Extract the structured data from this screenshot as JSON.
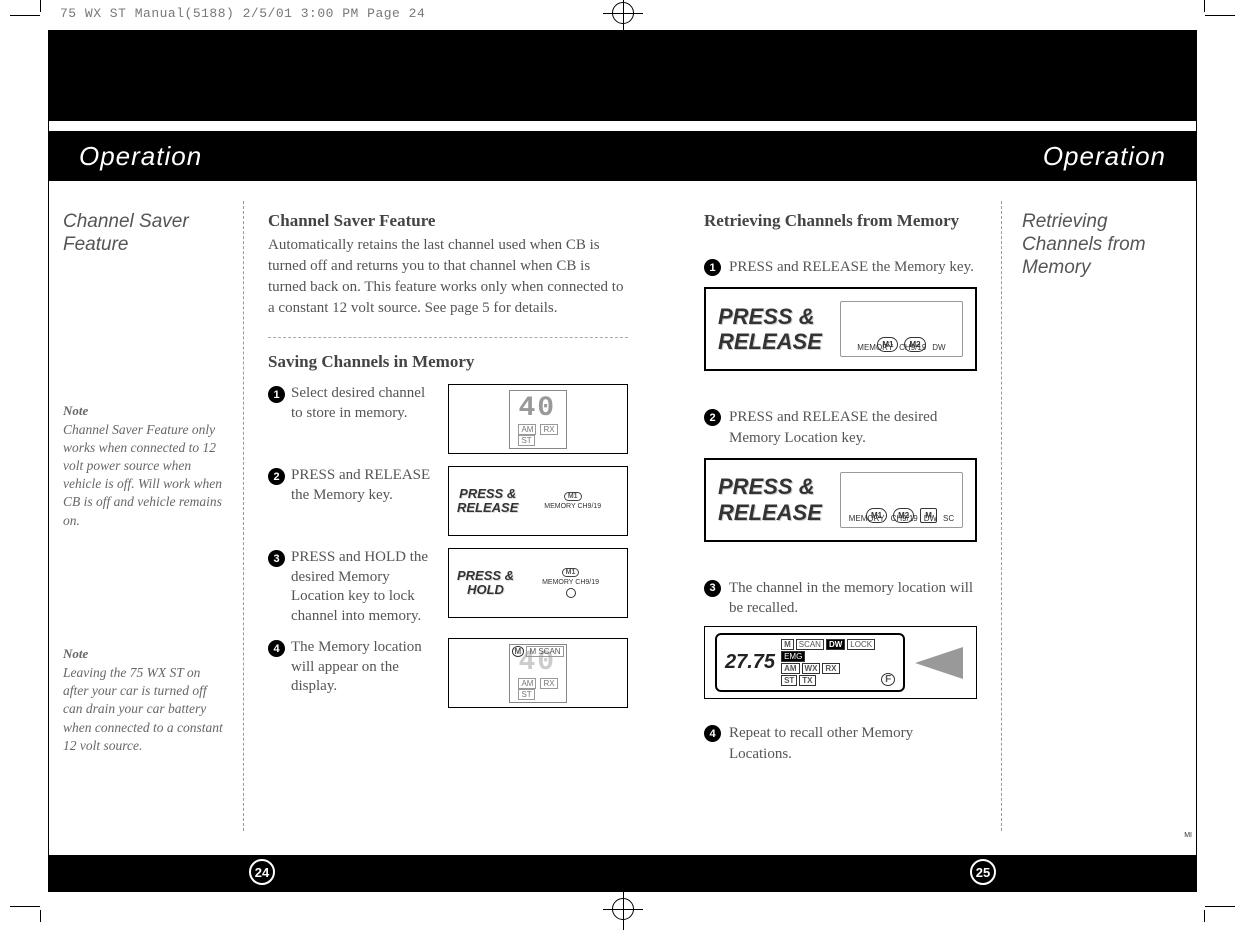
{
  "header_info": "75 WX ST Manual(5188)  2/5/01  3:00 PM  Page 24",
  "titles": {
    "left": "Operation",
    "right": "Operation"
  },
  "left_side": {
    "title": "Channel Saver Feature",
    "note1_label": "Note",
    "note1_body": "Channel Saver Feature only works when connected to 12 volt power source when vehicle is off. Will work when CB is off and vehicle remains on.",
    "note2_label": "Note",
    "note2_body": "Leaving the 75 WX ST on after your car is turned off can drain your car battery when connected to a constant 12 volt source."
  },
  "left_main": {
    "sec1_title": "Channel Saver Feature",
    "sec1_body": "Automatically retains the last channel used when CB is turned off and returns you to that channel when CB is turned back on. This feature works only when connected to a constant 12 volt source. See page 5 for details.",
    "sec2_title": "Saving Channels in Memory",
    "steps": [
      "Select desired channel to store in memory.",
      "PRESS and RELEASE the Memory key.",
      "PRESS and HOLD the desired Memory Location key to lock channel into memory.",
      "The Memory location will appear on the display."
    ],
    "press_release_label": "PRESS &\nRELEASE",
    "press_hold_label": "PRESS &\nHOLD",
    "lcd_40": "40",
    "lcd_tags_am": "AM",
    "lcd_tags_rx": "RX",
    "lcd_tags_st": "ST",
    "btn_memory": "MEMORY",
    "btn_ch919": "CH9/19",
    "btn_m1": "M1",
    "btn_m2": "M2",
    "btn_dw": "DW",
    "lcd_m_scan": "M SCAN"
  },
  "right_main": {
    "sec1_title": "Retrieving Channels from Memory",
    "steps": [
      "PRESS and RELEASE the Memory key.",
      "PRESS and RELEASE the desired Memory Location key.",
      "The channel in the memory location will be recalled.",
      "Repeat to recall other Memory Locations."
    ],
    "press_release_label": "PRESS &\nRELEASE",
    "btn_memory": "MEMORY",
    "btn_ch919": "CH9/19",
    "btn_m1": "M1",
    "btn_m2": "M2",
    "btn_dw": "DW",
    "btn_sc": "SC",
    "btn_mi": "MI",
    "recall_num": "27.75",
    "recall_tags": [
      "M",
      "SCAN",
      "DW",
      "LOCK",
      "EMG",
      "AM",
      "WX",
      "RX",
      "ST",
      "TX",
      "F"
    ]
  },
  "right_side": {
    "title": "Retrieving Channels from Memory"
  },
  "page_left": "24",
  "page_right": "25"
}
